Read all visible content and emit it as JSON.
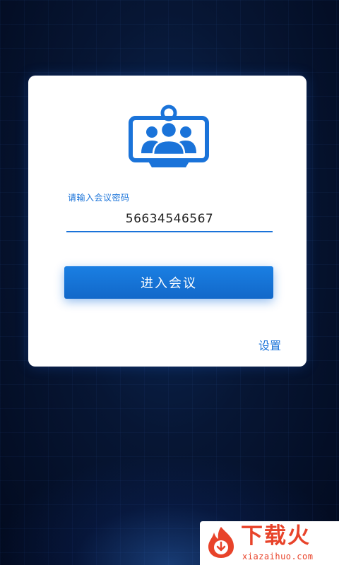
{
  "login": {
    "password_label": "请输入会议密码",
    "password_value": "56634546567",
    "enter_button": "进入会议",
    "settings_link": "设置"
  },
  "watermark": {
    "title": "下载火",
    "subtitle": "xiazaihuo.com"
  },
  "icons": {
    "logo": "video-conference-icon",
    "watermark_logo": "flame-download-icon"
  },
  "colors": {
    "accent": "#1a73d9",
    "button": "#1a7fe3",
    "background": "#071634",
    "watermark": "#e8432a"
  }
}
